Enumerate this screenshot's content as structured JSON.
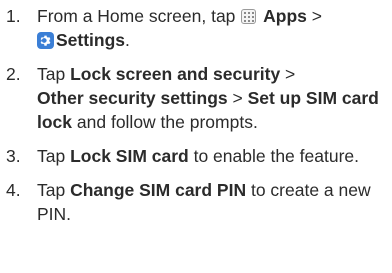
{
  "steps": [
    {
      "number": "1.",
      "t1": "From a Home screen, tap ",
      "b1": "Apps",
      "t2": " > ",
      "b2": "Settings",
      "t3": "."
    },
    {
      "number": "2.",
      "t1": "Tap ",
      "b1": "Lock screen and security",
      "t2": " > ",
      "b2": "Other security settings",
      "t3": " > ",
      "b3": "Set up SIM card lock",
      "t4": " and follow the prompts."
    },
    {
      "number": "3.",
      "t1": "Tap ",
      "b1": "Lock SIM card",
      "t2": " to enable the feature."
    },
    {
      "number": "4.",
      "t1": "Tap ",
      "b1": "Change SIM card PIN",
      "t2": " to create a new PIN."
    }
  ],
  "icons": {
    "apps": "apps-grid-icon",
    "settings": "settings-gear-icon"
  },
  "colors": {
    "settings_icon_bg": "#3b7fd6",
    "text": "#2b2b2b"
  }
}
